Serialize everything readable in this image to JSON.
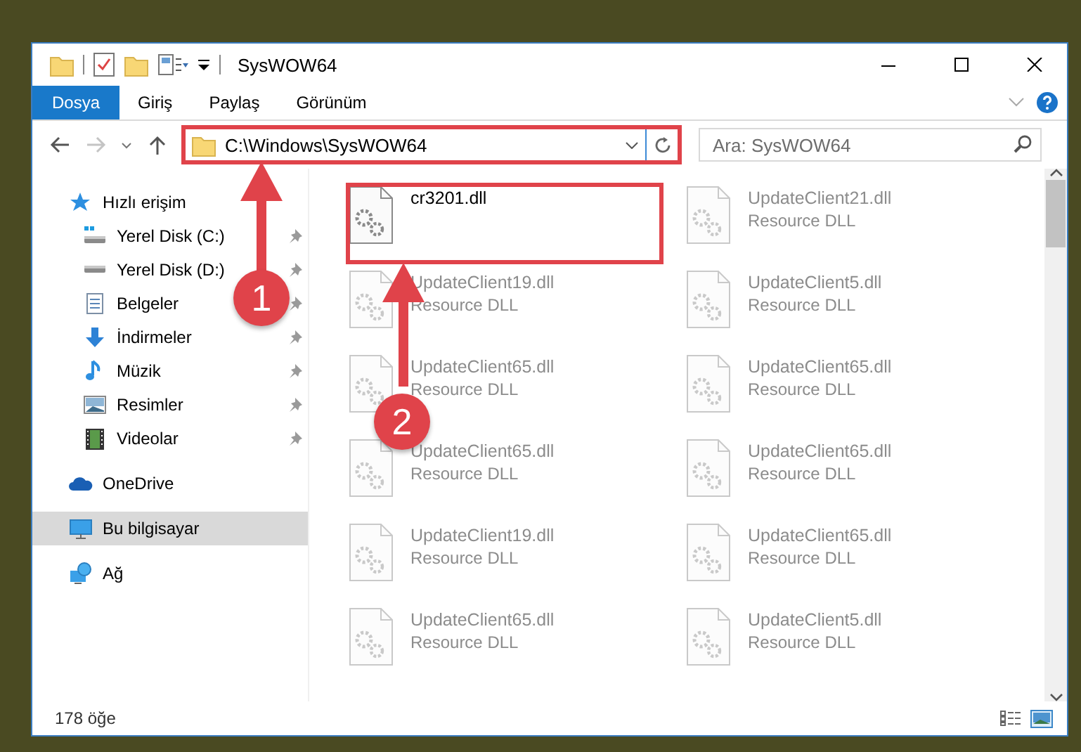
{
  "window": {
    "title": "SysWOW64"
  },
  "ribbon_tabs": [
    {
      "label": "Dosya",
      "selected": true
    },
    {
      "label": "Giriş",
      "selected": false
    },
    {
      "label": "Paylaş",
      "selected": false
    },
    {
      "label": "Görünüm",
      "selected": false
    }
  ],
  "address_bar": {
    "value": "C:\\Windows\\SysWOW64",
    "highlighted": true
  },
  "search": {
    "placeholder": "Ara: SysWOW64"
  },
  "sidebar": {
    "items": [
      {
        "label": "Hızlı erişim",
        "kind": "star",
        "selected": false,
        "children": [
          {
            "label": "Yerel Disk (C:)",
            "kind": "drive-c",
            "selected": false,
            "pinned": true
          },
          {
            "label": "Yerel Disk (D:)",
            "kind": "drive",
            "selected": false,
            "pinned": true
          },
          {
            "label": "Belgeler",
            "kind": "document",
            "selected": false,
            "pinned": true
          },
          {
            "label": "İndirmeler",
            "kind": "download",
            "selected": false,
            "pinned": true
          },
          {
            "label": "Müzik",
            "kind": "music",
            "selected": false,
            "pinned": true
          },
          {
            "label": "Resimler",
            "kind": "picture",
            "selected": false,
            "pinned": true
          },
          {
            "label": "Videolar",
            "kind": "video",
            "selected": false,
            "pinned": true
          }
        ]
      },
      {
        "label": "OneDrive",
        "kind": "cloud",
        "selected": false
      },
      {
        "label": "Bu bilgisayar",
        "kind": "computer",
        "selected": true
      },
      {
        "label": "Ağ",
        "kind": "network",
        "selected": false
      }
    ]
  },
  "files": [
    {
      "name": "cr3201.dll",
      "blurred": false,
      "highlighted": true
    },
    {
      "name": "UpdateClient21.dll",
      "type": "Resource DLL",
      "blurred": true,
      "highlighted": false
    },
    {
      "name": "UpdateClient19.dll",
      "type": "Resource DLL",
      "blurred": true,
      "highlighted": false
    },
    {
      "name": "UpdateClient5.dll",
      "type": "Resource DLL",
      "blurred": true,
      "highlighted": false
    },
    {
      "name": "UpdateClient65.dll",
      "type": "Resource DLL",
      "blurred": true,
      "highlighted": false
    },
    {
      "name": "UpdateClient65.dll",
      "type": "Resource DLL",
      "blurred": true,
      "highlighted": false
    },
    {
      "name": "UpdateClient65.dll",
      "type": "Resource DLL",
      "blurred": true,
      "highlighted": false
    },
    {
      "name": "UpdateClient65.dll",
      "type": "Resource DLL",
      "blurred": true,
      "highlighted": false
    },
    {
      "name": "UpdateClient19.dll",
      "type": "Resource DLL",
      "blurred": true,
      "highlighted": false
    },
    {
      "name": "UpdateClient65.dll",
      "type": "Resource DLL",
      "blurred": true,
      "highlighted": false
    },
    {
      "name": "UpdateClient65.dll",
      "type": "Resource DLL",
      "blurred": true,
      "highlighted": false
    },
    {
      "name": "UpdateClient5.dll",
      "type": "Resource DLL",
      "blurred": true,
      "highlighted": false
    }
  ],
  "status_bar": {
    "count": "178 öğe"
  },
  "annotations": [
    {
      "label": "1"
    },
    {
      "label": "2"
    }
  ]
}
